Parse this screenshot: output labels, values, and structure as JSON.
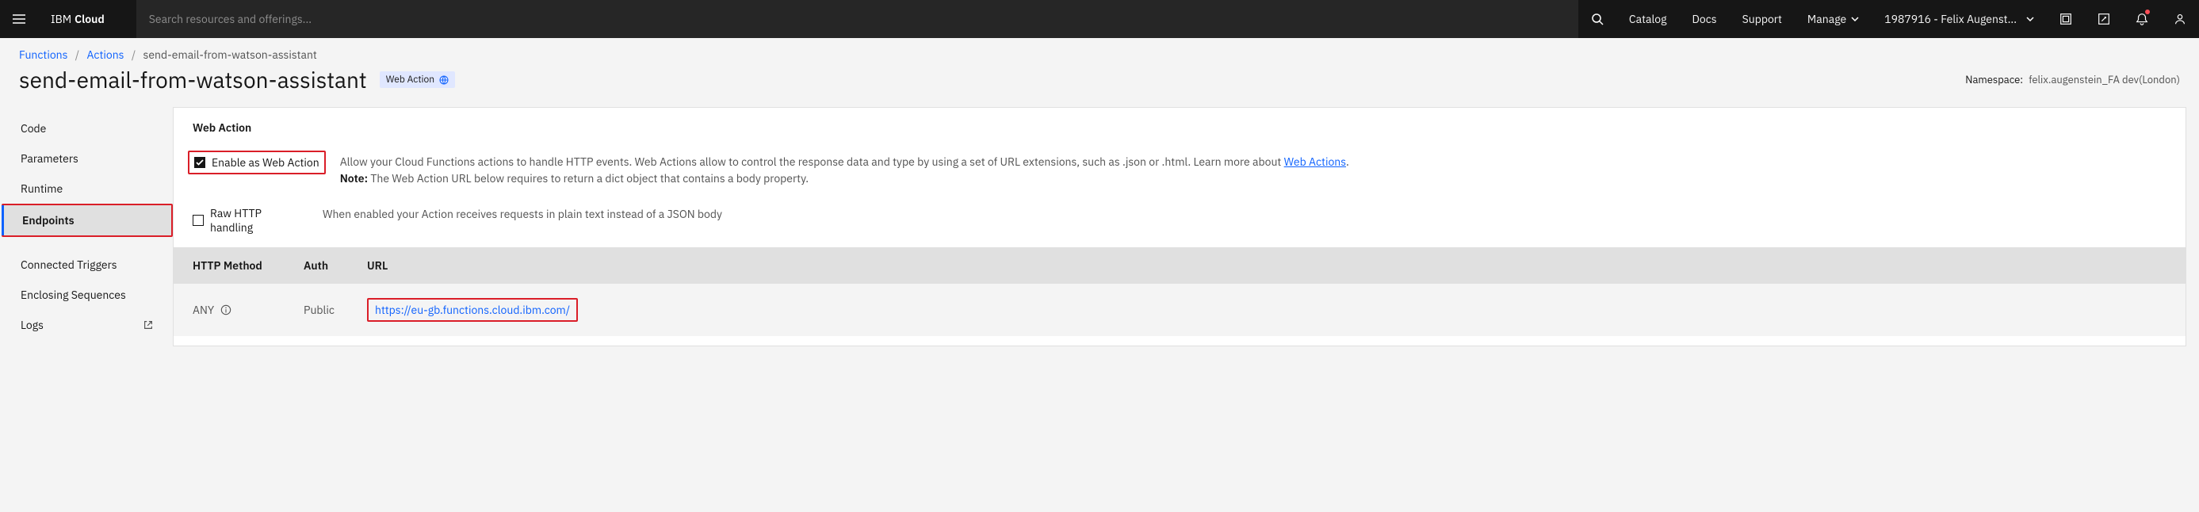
{
  "header": {
    "brand_ibm": "IBM",
    "brand_cloud": "Cloud",
    "search_placeholder": "Search resources and offerings...",
    "links": {
      "catalog": "Catalog",
      "docs": "Docs",
      "support": "Support",
      "manage": "Manage"
    },
    "account": "1987916 - Felix Augenst..."
  },
  "breadcrumbs": {
    "functions": "Functions",
    "actions": "Actions",
    "current": "send-email-from-watson-assistant"
  },
  "page_title": "send-email-from-watson-assistant",
  "badge_label": "Web Action",
  "namespace_label": "Namespace:",
  "namespace_value": "felix.augenstein_FA dev(London)",
  "sidebar": {
    "code": "Code",
    "parameters": "Parameters",
    "runtime": "Runtime",
    "endpoints": "Endpoints",
    "connected_triggers": "Connected Triggers",
    "enclosing_sequences": "Enclosing Sequences",
    "logs": "Logs"
  },
  "main": {
    "section_title": "Web Action",
    "enable_label": "Enable as Web Action",
    "enable_desc_1": "Allow your Cloud Functions actions to handle HTTP events. Web Actions allow to control the response data and type by using a set of URL extensions, such as .json or .html. Learn more about ",
    "enable_desc_link": "Web Actions",
    "enable_desc_2": ".",
    "enable_note_label": "Note:",
    "enable_note_text": " The Web Action URL below requires to return a dict object that contains a body property.",
    "raw_label": "Raw HTTP handling",
    "raw_desc": "When enabled your Action receives requests in plain text instead of a JSON body",
    "table": {
      "col_method": "HTTP Method",
      "col_auth": "Auth",
      "col_url": "URL",
      "method_value": "ANY",
      "auth_value": "Public",
      "url_value": "https://eu-gb.functions.cloud.ibm.com/"
    }
  }
}
